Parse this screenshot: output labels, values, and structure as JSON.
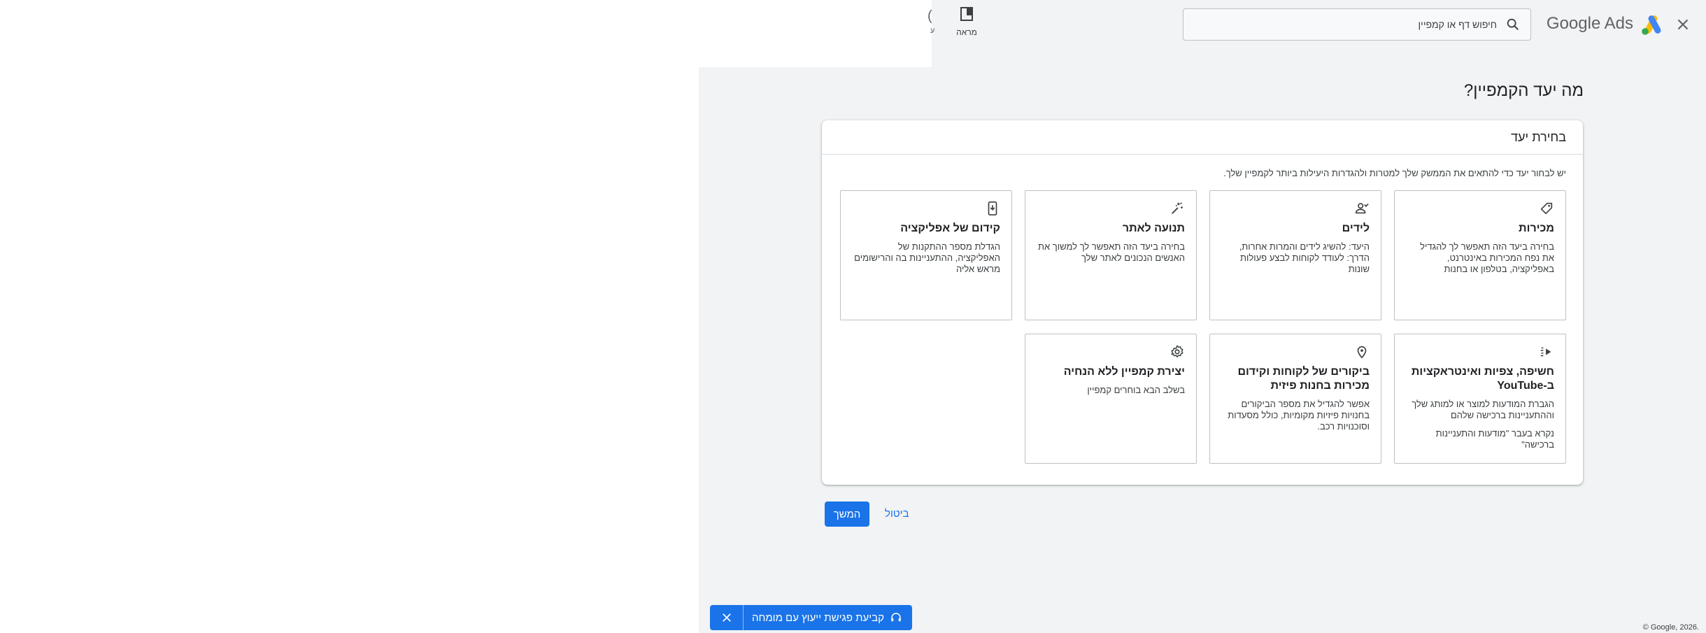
{
  "header": {
    "brand": "Google Ads",
    "search_placeholder": "חיפוש דף או קמפיין",
    "view_label": "מראה",
    "partial_icon_glyph": "(",
    "partial_label": "ע"
  },
  "page": {
    "title": "מה יעד הקמפיין?"
  },
  "card": {
    "title": "בחירת יעד",
    "description": "יש לבחור יעד כדי להתאים את הממשק שלך למטרות ולהגדרות היעילות ביותר לקמפיין שלך."
  },
  "goals": [
    {
      "icon": "tag-icon",
      "title": "מכירות",
      "desc": "בחירה ביעד הזה תאפשר לך להגדיל את נפח המכירות באינטרנט, באפליקציה, בטלפון או בחנות"
    },
    {
      "icon": "lead-person-icon",
      "title": "לידים",
      "desc": "היעד: להשיג לידים והמרות אחרות, הדרך: לעודד לקוחות לבצע פעולות שונות"
    },
    {
      "icon": "sparkle-cursor-icon",
      "title": "תנועה לאתר",
      "desc": "בחירה ביעד הזה תאפשר לך למשוך את האנשים הנכונים לאתר שלך"
    },
    {
      "icon": "phone-download-icon",
      "title": "קידום של אפליקציה",
      "desc": "הגדלת מספר ההתקנות של האפליקציה, ההתעניינות בה והרישומים מראש אליה"
    },
    {
      "icon": "youtube-play-icon",
      "title": "חשיפה, צפיות ואינטראקציות ב-YouTube",
      "desc": "הגברת המודעות למוצר או למותג שלך וההתעניינות ברכישה שלהם",
      "note": "נקרא בעבר \"מודעות והתעניינות ברכישה\""
    },
    {
      "icon": "map-pin-icon",
      "title": "ביקורים של לקוחות וקידום מכירות בחנות פיזית",
      "desc": "אפשר להגדיל את מספר הביקורים בחנויות פיזיות מקומיות, כולל מסעדות וסוכנויות רכב."
    },
    {
      "icon": "gear-icon",
      "title": "יצירת קמפיין ללא הנחיה",
      "desc": "בשלב הבא בוחרים קמפיין"
    }
  ],
  "actions": {
    "continue": "המשך",
    "cancel": "ביטול"
  },
  "consult": {
    "label": "קביעת פגישת ייעוץ עם מומחה"
  },
  "footer": {
    "copyright": "© Google, 2026."
  },
  "colors": {
    "accent": "#1a73e8",
    "background": "#f1f3f4"
  }
}
